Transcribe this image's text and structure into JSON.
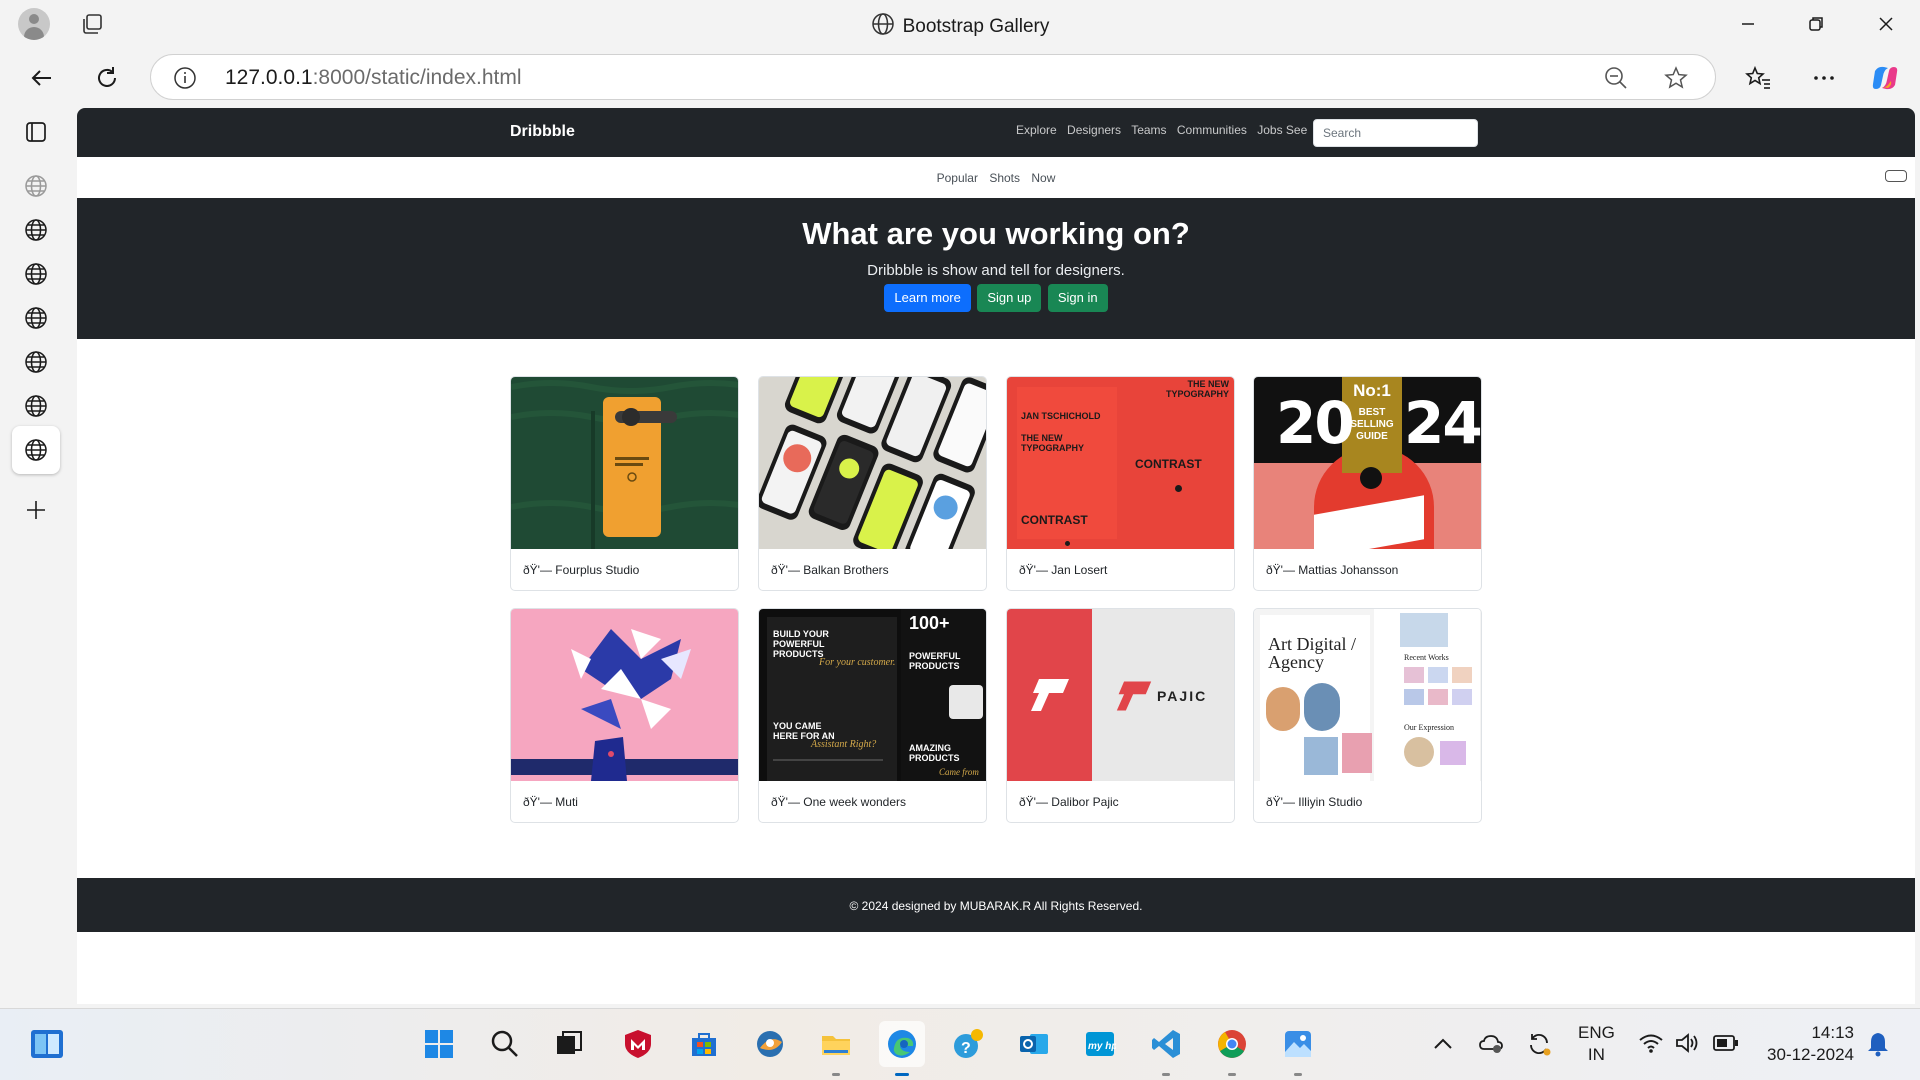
{
  "window": {
    "title": "Bootstrap Gallery",
    "controls": [
      "minimize",
      "restore",
      "close"
    ]
  },
  "address_bar": {
    "host": "127.0.0.1",
    "path": ":8000/static/index.html"
  },
  "sidebar": {
    "icons": [
      "tab-actions-icon",
      "globe-icon",
      "globe-icon",
      "globe-icon",
      "globe-icon",
      "globe-icon",
      "globe-icon",
      "globe-icon",
      "add-icon"
    ]
  },
  "page": {
    "navbar": {
      "brand": "Dribbble",
      "links": [
        "Explore",
        "Designers",
        "Teams",
        "Communities",
        "Jobs See"
      ],
      "search_placeholder": "Search"
    },
    "subnav": [
      "Popular",
      "Shots",
      "Now"
    ],
    "hero": {
      "heading": "What are you working on?",
      "subheading": "Dribbble is show and tell for designers.",
      "learn_more": "Learn more",
      "sign_up": "Sign up",
      "sign_in": "Sign in"
    },
    "cards": [
      {
        "caption": "ðŸ'— Fourplus Studio",
        "color": "#1f4a34"
      },
      {
        "caption": "ðŸ'— Balkan Brothers",
        "color": "#d8d6cf"
      },
      {
        "caption": "ðŸ'— Jan Losert",
        "color": "#e8443a"
      },
      {
        "caption": "ðŸ'— Mattias Johansson",
        "color": "#111111"
      },
      {
        "caption": "ðŸ'— Muti",
        "color": "#f6a6c0"
      },
      {
        "caption": "ðŸ'— One week wonders",
        "color": "#0e0e0e"
      },
      {
        "caption": "ðŸ'— Dalibor Pajic",
        "color": "#e8e8e8"
      },
      {
        "caption": "ðŸ'— Illiyin Studio",
        "color": "#f4f4f4"
      }
    ],
    "thumb_text": {
      "c3_line1": "JAN TSCHICHOLD",
      "c3_line2": "THE NEW TYPOGRAPHY",
      "c3_line3": "CONTRAST",
      "c3_right_top": "THE NEW TYPOGRAPHY",
      "c4_left": "20",
      "c4_right": "24",
      "c4_badge_1": "No:1",
      "c4_badge_2": "BEST SELLING GUIDE",
      "c6_top": "BUILD YOUR POWERFUL PRODUCTS",
      "c6_script": "For your customer.",
      "c6_num": "100+",
      "c6_right": "POWERFUL PRODUCTS",
      "c6_bottom_left": "YOU CAME HERE FOR AN",
      "c6_bottom_script": "Assistant Right?",
      "c6_bottom_right": "AMAZING PRODUCTS",
      "c6_came": "Came from",
      "c7_brand": "PAJIC",
      "c8_title": "Art Digital / Agency",
      "c8_recent": "Recent Works",
      "c8_expr": "Our Expression"
    },
    "footer": "© 2024 designed by MUBARAK.R All Rights Reserved."
  },
  "taskbar": {
    "apps": [
      "start-icon",
      "search-icon",
      "task-view-icon",
      "mcafee-icon",
      "store-icon",
      "photos-icon",
      "file-explorer-icon",
      "edge-icon",
      "tips-icon",
      "outlook-icon",
      "myhp-icon",
      "vscode-icon",
      "chrome-icon",
      "photos-app-icon"
    ],
    "lang_1": "ENG",
    "lang_2": "IN",
    "time": "14:13",
    "date": "30-12-2024"
  }
}
